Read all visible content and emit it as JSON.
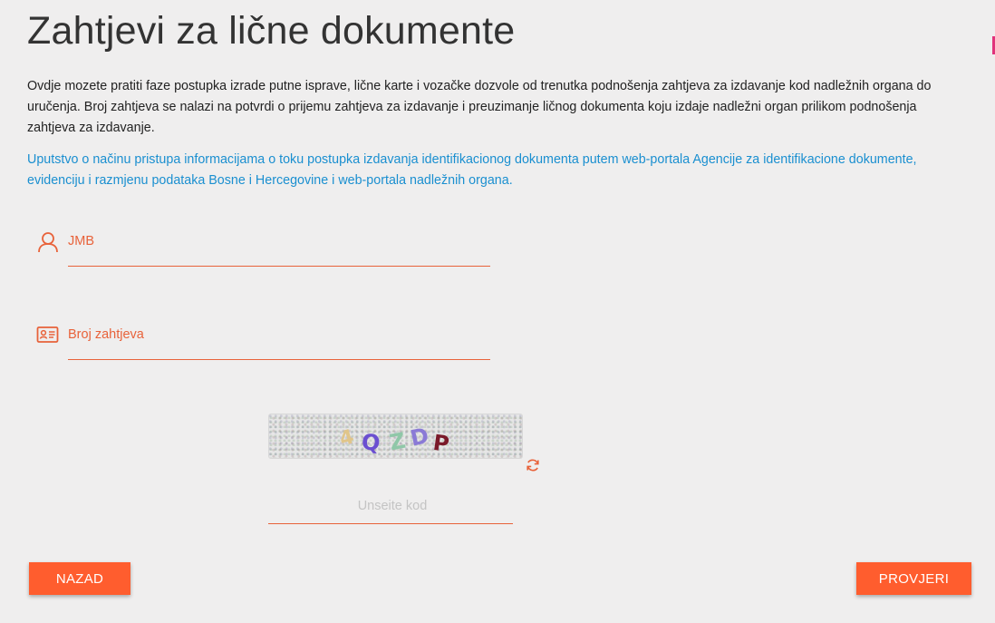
{
  "page": {
    "title": "Zahtjevi za lične dokumente",
    "intro": "Ovdje mozete pratiti faze postupka izrade putne isprave, lične karte i vozačke dozvole od trenutka podnošenja zahtjeva za izdavanje kod nadležnih organa do uručenja. Broj zahtjeva se nalazi na potvrdi o prijemu zahtjeva za izdavanje i preuzimanje ličnog dokumenta koju izdaje nadležni organ prilikom podnošenja zahtjeva za izdavanje.",
    "help_link": "Uputstvo o načinu pristupa informacijama o toku postupka izdavanja identifikacionog dokumenta putem web-portala Agencije za identifikacione dokumente, evidenciju i razmjenu podataka Bosne i Hercegovine i web-portala nadležnih organa."
  },
  "form": {
    "jmb": {
      "label": "JMB",
      "value": "",
      "icon": "user-icon"
    },
    "request_number": {
      "label": "Broj zahtjeva",
      "value": "",
      "icon": "id-card-icon"
    },
    "captcha": {
      "characters": [
        "4",
        "Q",
        "Z",
        "D",
        "P"
      ],
      "colors": [
        "#e0c58a",
        "#6a4fd1",
        "#8fc7a8",
        "#8a7ad6",
        "#7a1a2a"
      ],
      "refresh_icon": "refresh-icon"
    },
    "code": {
      "placeholder": "Unseite kod",
      "value": ""
    }
  },
  "buttons": {
    "back": "NAZAD",
    "check": "PROVJERI"
  },
  "colors": {
    "accent": "#ff5d2e",
    "field_accent": "#e8623a",
    "link": "#1a8fd0",
    "background": "#efeeee"
  }
}
